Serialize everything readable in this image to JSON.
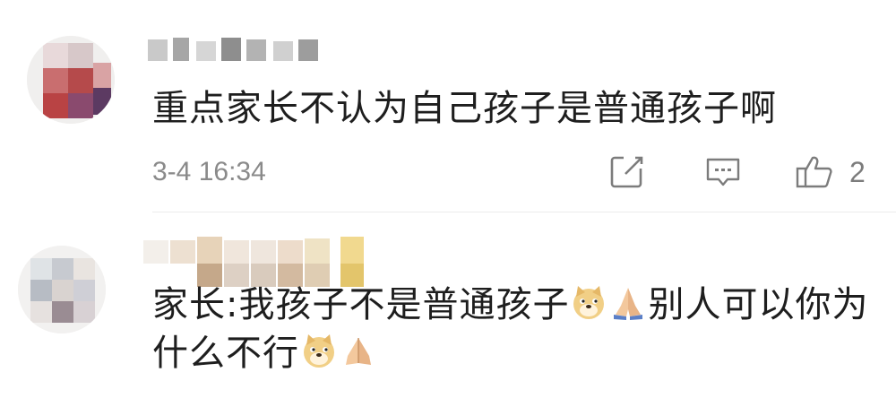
{
  "comments": [
    {
      "username": "",
      "text": "重点家长不认为自己孩子是普通孩子啊",
      "time": "3-4 16:34",
      "like_count": "2"
    },
    {
      "username": "",
      "text_part1": "家长:我孩子不是普通孩子",
      "text_part2": "别人可以你为什么不行",
      "emojis": [
        "doge-emoji",
        "pray-emoji",
        "doge-emoji",
        "pray-emoji"
      ]
    }
  ],
  "icons": [
    "edit-icon",
    "comment-icon",
    "like-icon"
  ],
  "colors": {
    "text": "#1e1e1e",
    "meta": "#8a8a8a",
    "divider": "#ececec"
  }
}
